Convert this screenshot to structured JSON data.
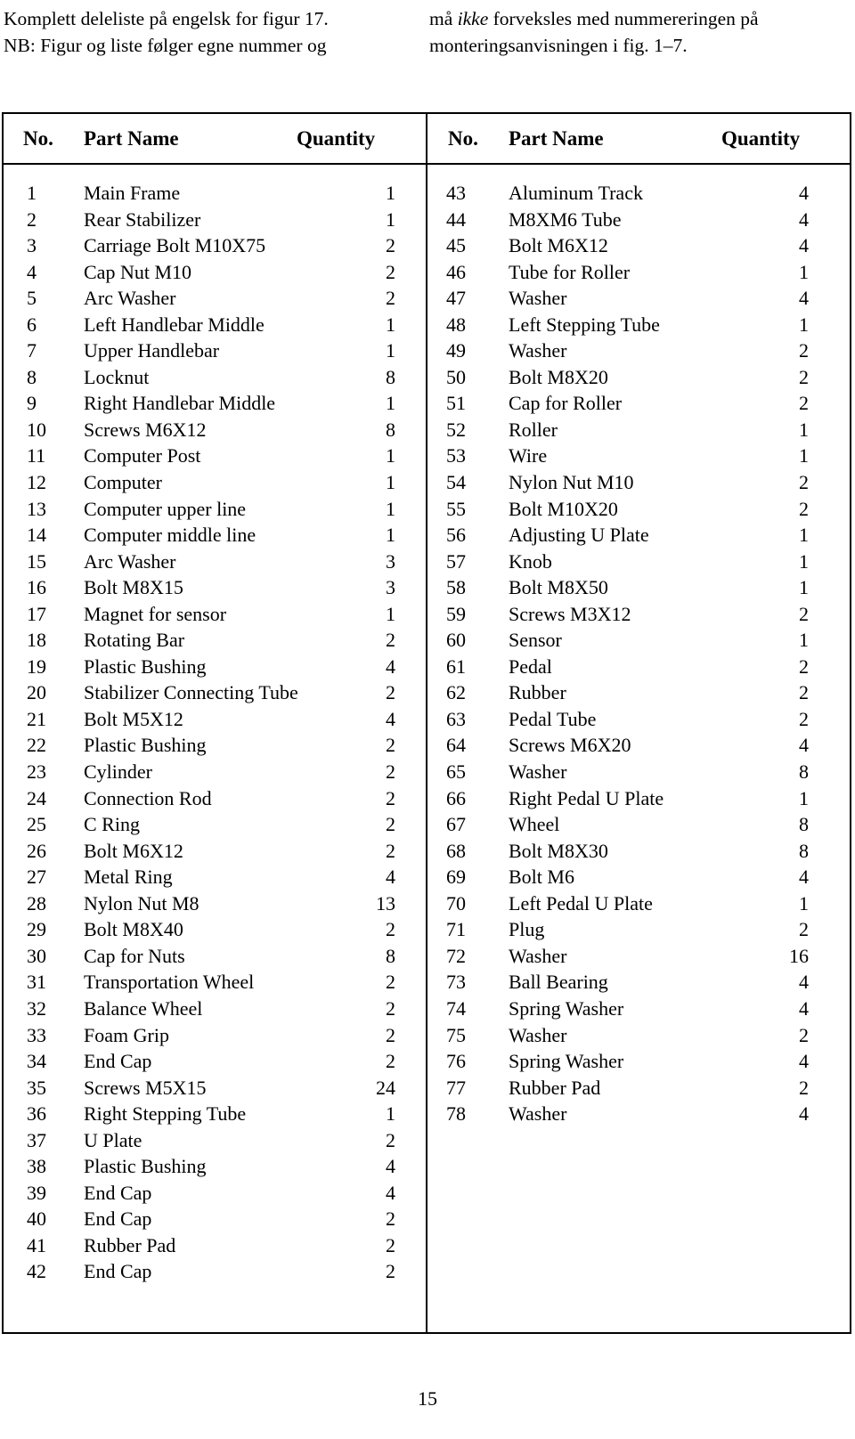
{
  "intro": {
    "left_lines": [
      "Komplett deleliste på engelsk for figur 17.",
      "NB: Figur og liste følger egne nummer og"
    ],
    "right_line_1_pre": "må ",
    "right_line_1_em": "ikke",
    "right_line_1_post": " forveksles med nummereringen på",
    "right_line_2": "monteringsanvisningen i fig. 1–7."
  },
  "table": {
    "headers": {
      "no": "No.",
      "part_name": "Part Name",
      "quantity": "Quantity"
    },
    "left_rows": [
      {
        "no": "1",
        "name": "Main Frame",
        "qty": "1"
      },
      {
        "no": "2",
        "name": "Rear Stabilizer",
        "qty": "1"
      },
      {
        "no": "3",
        "name": "Carriage Bolt M10X75",
        "qty": "2"
      },
      {
        "no": "4",
        "name": "Cap Nut M10",
        "qty": "2"
      },
      {
        "no": "5",
        "name": "Arc Washer",
        "qty": "2"
      },
      {
        "no": "6",
        "name": "Left Handlebar Middle",
        "qty": "1"
      },
      {
        "no": "7",
        "name": "Upper Handlebar",
        "qty": "1"
      },
      {
        "no": "8",
        "name": "Locknut",
        "qty": "8"
      },
      {
        "no": "9",
        "name": "Right Handlebar Middle",
        "qty": "1"
      },
      {
        "no": "10",
        "name": "Screws M6X12",
        "qty": "8"
      },
      {
        "no": "11",
        "name": "Computer Post",
        "qty": "1"
      },
      {
        "no": "12",
        "name": "Computer",
        "qty": "1"
      },
      {
        "no": "13",
        "name": "Computer upper line",
        "qty": "1"
      },
      {
        "no": "14",
        "name": "Computer middle line",
        "qty": "1"
      },
      {
        "no": "15",
        "name": "Arc Washer",
        "qty": "3"
      },
      {
        "no": "16",
        "name": "Bolt M8X15",
        "qty": "3"
      },
      {
        "no": "17",
        "name": "Magnet for sensor",
        "qty": "1"
      },
      {
        "no": "18",
        "name": "Rotating Bar",
        "qty": "2"
      },
      {
        "no": "19",
        "name": "Plastic Bushing",
        "qty": "4"
      },
      {
        "no": "20",
        "name": "Stabilizer Connecting Tube",
        "qty": "2"
      },
      {
        "no": "21",
        "name": "Bolt M5X12",
        "qty": "4"
      },
      {
        "no": "22",
        "name": "Plastic Bushing",
        "qty": "2"
      },
      {
        "no": "23",
        "name": "Cylinder",
        "qty": "2"
      },
      {
        "no": "24",
        "name": "Connection Rod",
        "qty": "2"
      },
      {
        "no": "25",
        "name": "C Ring",
        "qty": "2"
      },
      {
        "no": "26",
        "name": "Bolt M6X12",
        "qty": "2"
      },
      {
        "no": "27",
        "name": "Metal Ring",
        "qty": "4"
      },
      {
        "no": "28",
        "name": "Nylon Nut M8",
        "qty": "13"
      },
      {
        "no": "29",
        "name": "Bolt M8X40",
        "qty": "2"
      },
      {
        "no": "30",
        "name": "Cap for Nuts",
        "qty": "8"
      },
      {
        "no": "31",
        "name": "Transportation Wheel",
        "qty": "2"
      },
      {
        "no": "32",
        "name": "Balance Wheel",
        "qty": "2"
      },
      {
        "no": "33",
        "name": "Foam Grip",
        "qty": "2"
      },
      {
        "no": "34",
        "name": "End Cap",
        "qty": "2"
      },
      {
        "no": "35",
        "name": "Screws M5X15",
        "qty": "24"
      },
      {
        "no": "36",
        "name": "Right Stepping Tube",
        "qty": "1"
      },
      {
        "no": "37",
        "name": "U Plate",
        "qty": "2"
      },
      {
        "no": "38",
        "name": "Plastic Bushing",
        "qty": "4"
      },
      {
        "no": "39",
        "name": "End Cap",
        "qty": "4"
      },
      {
        "no": "40",
        "name": "End Cap",
        "qty": "2"
      },
      {
        "no": "41",
        "name": "Rubber Pad",
        "qty": "2"
      },
      {
        "no": "42",
        "name": "End Cap",
        "qty": "2"
      }
    ],
    "right_rows": [
      {
        "no": "43",
        "name": "Aluminum Track",
        "qty": "4"
      },
      {
        "no": "44",
        "name": "M8XM6 Tube",
        "qty": "4"
      },
      {
        "no": "45",
        "name": "Bolt M6X12",
        "qty": "4"
      },
      {
        "no": "46",
        "name": "Tube for Roller",
        "qty": "1"
      },
      {
        "no": "47",
        "name": "Washer",
        "qty": "4"
      },
      {
        "no": "48",
        "name": "Left Stepping Tube",
        "qty": "1"
      },
      {
        "no": "49",
        "name": "Washer",
        "qty": "2"
      },
      {
        "no": "50",
        "name": "Bolt M8X20",
        "qty": "2"
      },
      {
        "no": "51",
        "name": "Cap for Roller",
        "qty": "2"
      },
      {
        "no": "52",
        "name": "Roller",
        "qty": "1"
      },
      {
        "no": "53",
        "name": "Wire",
        "qty": "1"
      },
      {
        "no": "54",
        "name": "Nylon Nut M10",
        "qty": "2"
      },
      {
        "no": "55",
        "name": "Bolt M10X20",
        "qty": "2"
      },
      {
        "no": "56",
        "name": "Adjusting U Plate",
        "qty": "1"
      },
      {
        "no": "57",
        "name": "Knob",
        "qty": "1"
      },
      {
        "no": "58",
        "name": "Bolt M8X50",
        "qty": "1"
      },
      {
        "no": "59",
        "name": "Screws M3X12",
        "qty": "2"
      },
      {
        "no": "60",
        "name": "Sensor",
        "qty": "1"
      },
      {
        "no": "61",
        "name": "Pedal",
        "qty": "2"
      },
      {
        "no": "62",
        "name": "Rubber",
        "qty": "2"
      },
      {
        "no": "63",
        "name": "Pedal Tube",
        "qty": "2"
      },
      {
        "no": "64",
        "name": "Screws M6X20",
        "qty": "4"
      },
      {
        "no": "65",
        "name": "Washer",
        "qty": "8"
      },
      {
        "no": "66",
        "name": "Right Pedal U Plate",
        "qty": "1"
      },
      {
        "no": "67",
        "name": "Wheel",
        "qty": "8"
      },
      {
        "no": "68",
        "name": "Bolt M8X30",
        "qty": "8"
      },
      {
        "no": "69",
        "name": "Bolt M6",
        "qty": "4"
      },
      {
        "no": "70",
        "name": "Left Pedal U Plate",
        "qty": "1"
      },
      {
        "no": "71",
        "name": "Plug",
        "qty": "2"
      },
      {
        "no": "72",
        "name": "Washer",
        "qty": "16"
      },
      {
        "no": "73",
        "name": "Ball Bearing",
        "qty": "4"
      },
      {
        "no": "74",
        "name": "Spring Washer",
        "qty": "4"
      },
      {
        "no": "75",
        "name": "Washer",
        "qty": "2"
      },
      {
        "no": "76",
        "name": "Spring Washer",
        "qty": "4"
      },
      {
        "no": "77",
        "name": "Rubber Pad",
        "qty": "2"
      },
      {
        "no": "78",
        "name": "Washer",
        "qty": "4"
      }
    ]
  },
  "footer": {
    "page_number": "15"
  }
}
